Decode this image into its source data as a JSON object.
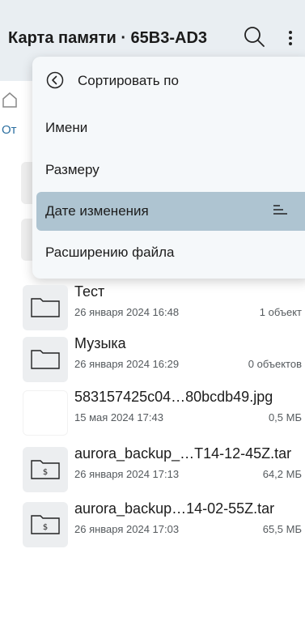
{
  "appbar": {
    "title": "Карта памяти · 65B3-AD3",
    "search_icon": "search-icon",
    "more_icon": "more-vert-icon"
  },
  "background": {
    "crumb_text": "От",
    "home_icon": "home-icon"
  },
  "sort_menu": {
    "header": "Сортировать по",
    "back_icon": "circle-chevron-left-icon",
    "items": [
      {
        "label": "Имени",
        "selected": false
      },
      {
        "label": "Размеру",
        "selected": false
      },
      {
        "label": "Дате изменения",
        "selected": true,
        "icon": "sort-lines-icon"
      },
      {
        "label": "Расширению файла",
        "selected": false
      }
    ]
  },
  "files": [
    {
      "name": "Тест",
      "date": "26 января 2024 16:48",
      "meta": "1 объект",
      "icon": "folder-icon"
    },
    {
      "name": "Музыка",
      "date": "26 января 2024 16:29",
      "meta": "0 объектов",
      "icon": "folder-icon"
    },
    {
      "name": "583157425c04…80bcdb49.jpg",
      "date": "15 мая 2024 17:43",
      "meta": "0,5 МБ",
      "icon": "image-thumbnail"
    },
    {
      "name": "aurora_backup_…T14-12-45Z.tar",
      "date": "26 января 2024 17:13",
      "meta": "64,2 МБ",
      "icon": "archive-icon"
    },
    {
      "name": "aurora_backup…14-02-55Z.tar",
      "date": "26 января 2024 17:03",
      "meta": "65,5 МБ",
      "icon": "archive-icon"
    }
  ],
  "colors": {
    "appbar_bg": "#e9eef2",
    "menu_bg": "#f5f8fa",
    "selected_bg": "#aec4d1",
    "link": "#2c6fa0"
  }
}
